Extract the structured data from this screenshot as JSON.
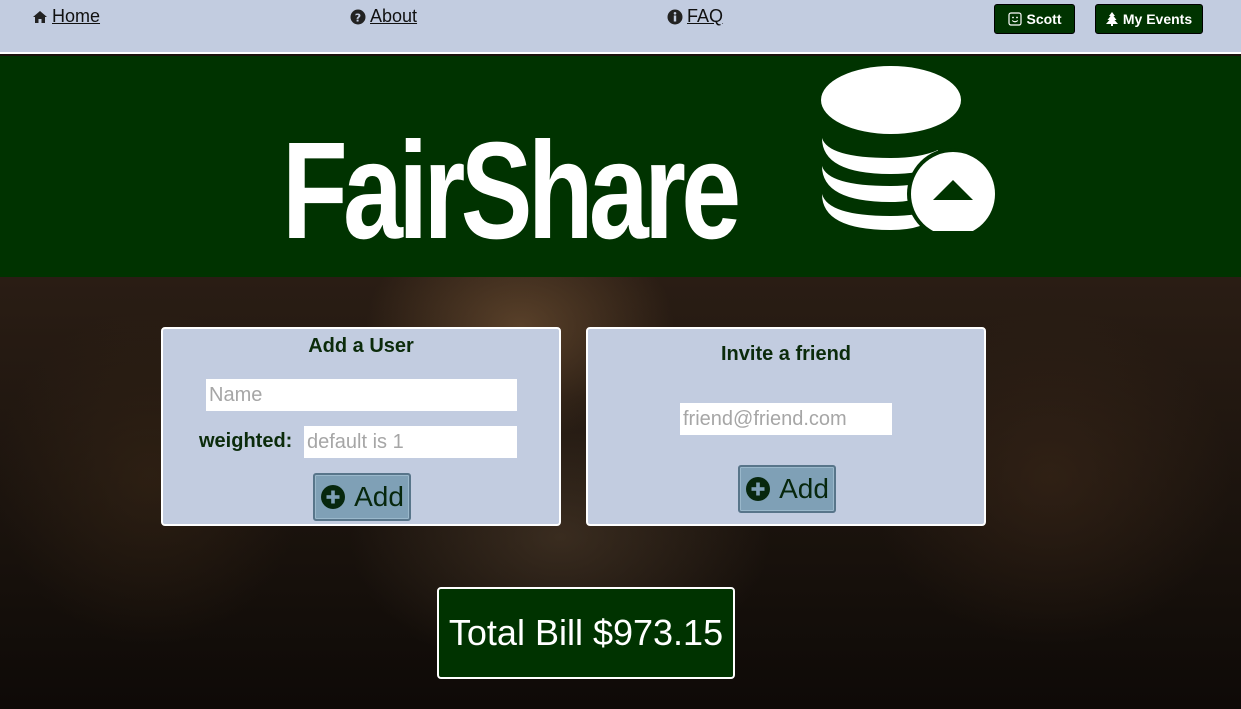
{
  "nav": {
    "home_label": "Home",
    "about_label": "About",
    "faq_label": "FAQ",
    "user_label": "Scott",
    "events_label": "My Events"
  },
  "logo": {
    "text": "FairShare"
  },
  "add_user": {
    "title": "Add a User",
    "name_placeholder": "Name",
    "weighted_label": "weighted:",
    "weighted_placeholder": "default is 1",
    "add_label": "Add"
  },
  "invite": {
    "title": "Invite a friend",
    "email_placeholder": "friend@friend.com",
    "add_label": "Add"
  },
  "total": {
    "label": "Total Bill $973.15"
  },
  "icons": {
    "home": "home-icon",
    "about": "question-circle-icon",
    "faq": "info-circle-icon",
    "user": "smiley-icon",
    "events": "tree-icon",
    "add": "plus-circle-icon",
    "logo": "coin-stack-up-arrow-icon"
  },
  "colors": {
    "nav_bg": "#c2cce0",
    "brand_green": "#003300",
    "card_bg": "#c2cce0",
    "button_bg": "#7fa0b6"
  }
}
